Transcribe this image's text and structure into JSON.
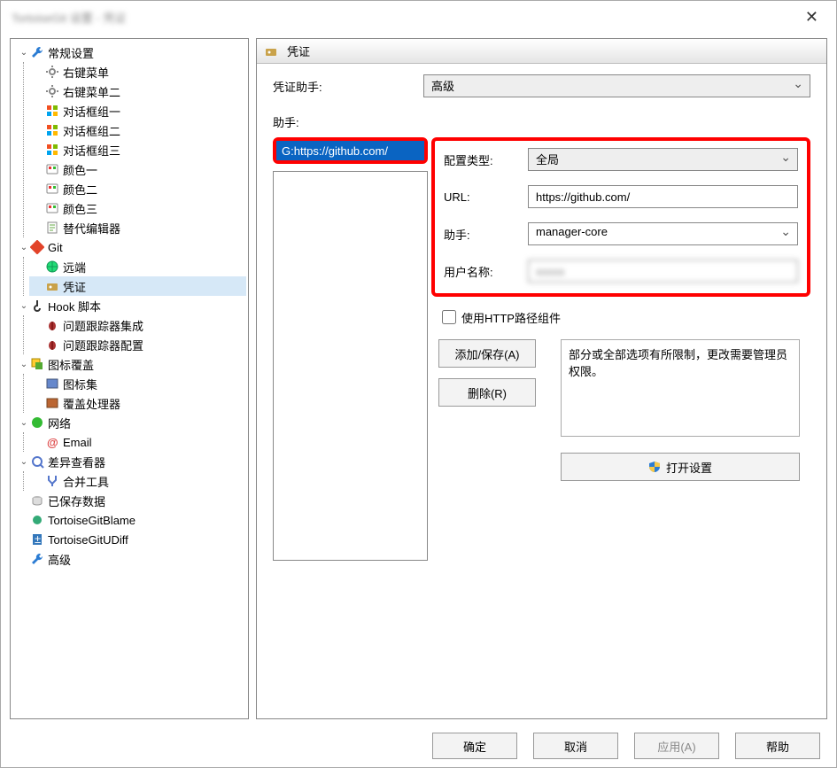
{
  "titlebar": {
    "left_blur": "TortoiseGit 设置 - 凭证"
  },
  "sidebar": {
    "items": [
      {
        "label": "常规设置",
        "icon": "wrench",
        "children": [
          {
            "label": "右键菜单",
            "icon": "gear"
          },
          {
            "label": "右键菜单二",
            "icon": "gear"
          },
          {
            "label": "对话框组一",
            "icon": "winflag"
          },
          {
            "label": "对话框组二",
            "icon": "winflag"
          },
          {
            "label": "对话框组三",
            "icon": "winflag"
          },
          {
            "label": "颜色一",
            "icon": "palette"
          },
          {
            "label": "颜色二",
            "icon": "palette"
          },
          {
            "label": "颜色三",
            "icon": "palette"
          },
          {
            "label": "替代编辑器",
            "icon": "edit"
          }
        ]
      },
      {
        "label": "Git",
        "icon": "git",
        "children": [
          {
            "label": "远端",
            "icon": "globe"
          },
          {
            "label": "凭证",
            "icon": "cred",
            "selected": true
          }
        ]
      },
      {
        "label": "Hook 脚本",
        "icon": "hook",
        "children": [
          {
            "label": "问题跟踪器集成",
            "icon": "bug"
          },
          {
            "label": "问题跟踪器配置",
            "icon": "bug"
          }
        ]
      },
      {
        "label": "图标覆盖",
        "icon": "overlay",
        "children": [
          {
            "label": "图标集",
            "icon": "iconset"
          },
          {
            "label": "覆盖处理器",
            "icon": "handler"
          }
        ]
      },
      {
        "label": "网络",
        "icon": "net",
        "children": [
          {
            "label": "Email",
            "icon": "email"
          }
        ]
      },
      {
        "label": "差异查看器",
        "icon": "diff",
        "children": [
          {
            "label": "合并工具",
            "icon": "merge"
          }
        ]
      },
      {
        "label": "已保存数据",
        "icon": "saved",
        "children": []
      },
      {
        "label": "TortoiseGitBlame",
        "icon": "blame",
        "children": []
      },
      {
        "label": "TortoiseGitUDiff",
        "icon": "udiff",
        "children": []
      },
      {
        "label": "高级",
        "icon": "wrench",
        "children": []
      }
    ]
  },
  "main": {
    "header_title": "凭证",
    "cred_helper_label": "凭证助手:",
    "cred_helper_value": "高级",
    "helper_label": "助手:",
    "helper_list": [
      "G:https://github.com/"
    ],
    "config": {
      "type_label": "配置类型:",
      "type_value": "全局",
      "url_label": "URL:",
      "url_value": "https://github.com/",
      "helper_label": "助手:",
      "helper_value": "manager-core",
      "username_label": "用户名称:",
      "username_value": "xxxxx"
    },
    "checkbox_label": "使用HTTP路径组件",
    "add_save_label": "添加/保存(A)",
    "delete_label": "删除(R)",
    "note_text": "部分或全部选项有所限制，更改需要管理员权限。",
    "open_settings_label": "打开设置"
  },
  "footer": {
    "ok": "确定",
    "cancel": "取消",
    "apply": "应用(A)",
    "help": "帮助"
  },
  "icons": {
    "wrench": "#2b7cd3",
    "gear": "#888",
    "winflag": "#3a8",
    "palette": "#c73",
    "edit": "#6a4",
    "git": "#e33",
    "globe": "#2a6",
    "cred": "#c93",
    "hook": "#333",
    "bug": "#a33",
    "overlay": "#5a3",
    "iconset": "#68c",
    "handler": "#b63",
    "net": "#3b3",
    "email": "#d44",
    "diff": "#57c",
    "merge": "#57c",
    "saved": "#888",
    "blame": "#3a7",
    "udiff": "#37b"
  }
}
